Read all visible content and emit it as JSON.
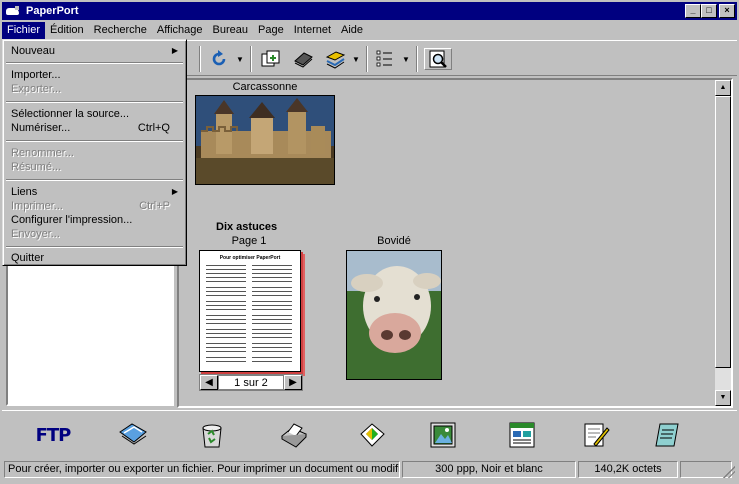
{
  "window": {
    "title": "PaperPort"
  },
  "title_buttons": {
    "minimize": "_",
    "maximize": "□",
    "close": "×"
  },
  "menubar": [
    {
      "label": "Fichier"
    },
    {
      "label": "Édition"
    },
    {
      "label": "Recherche"
    },
    {
      "label": "Affichage"
    },
    {
      "label": "Bureau"
    },
    {
      "label": "Page"
    },
    {
      "label": "Internet"
    },
    {
      "label": "Aide"
    }
  ],
  "file_menu": [
    {
      "label": "Nouveau",
      "submenu": true
    },
    {
      "label": "Importer..."
    },
    {
      "label": "Exporter...",
      "disabled": true
    },
    {
      "label": "Sélectionner la source..."
    },
    {
      "label": "Numériser...",
      "shortcut": "Ctrl+Q"
    },
    {
      "label": "Renommer...",
      "disabled": true
    },
    {
      "label": "Résumé...",
      "disabled": true
    },
    {
      "label": "Liens",
      "submenu": true
    },
    {
      "label": "Imprimer...",
      "shortcut": "Ctrl+P",
      "disabled": true
    },
    {
      "label": "Configurer l'impression..."
    },
    {
      "label": "Envoyer...",
      "disabled": true
    },
    {
      "label": "Quitter"
    }
  ],
  "desktop_items": {
    "carcassonne": {
      "label": "Carcassonne"
    },
    "doc": {
      "title": "Dix astuces",
      "page": "Page 1",
      "doc_heading": "Pour optimiser PaperPort",
      "pager_text": "1 sur 2"
    },
    "bovide": {
      "label": "Bovidé"
    }
  },
  "dock": {
    "ftp_label": "FTP"
  },
  "statusbar": {
    "message": "Pour créer, importer ou exporter un fichier. Pour imprimer un document ou modifier son",
    "resolution": "300 ppp, Noir et blanc",
    "size": "140,2K octets"
  },
  "colors": {
    "titlebar": "#000080",
    "window": "#c0c0c0",
    "ftp_text": "#000080"
  }
}
